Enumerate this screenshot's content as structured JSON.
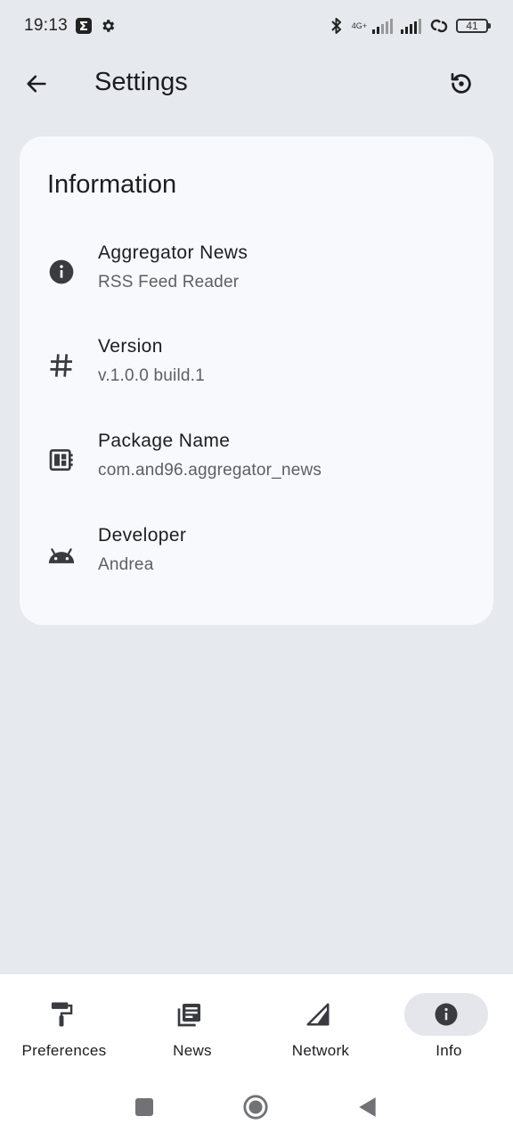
{
  "status_bar": {
    "time": "19:13",
    "network_label": "4G+",
    "battery": "41"
  },
  "top_bar": {
    "title": "Settings"
  },
  "card": {
    "title": "Information",
    "items": [
      {
        "icon": "info-icon",
        "label": "Aggregator News",
        "value": "RSS Feed Reader"
      },
      {
        "icon": "hashtag-icon",
        "label": "Version",
        "value": "v.1.0.0 build.1"
      },
      {
        "icon": "package-icon",
        "label": "Package Name",
        "value": "com.and96.aggregator_news"
      },
      {
        "icon": "android-icon",
        "label": "Developer",
        "value": "Andrea"
      }
    ]
  },
  "bottom_nav": {
    "items": [
      {
        "icon": "paint-roller-icon",
        "label": "Preferences",
        "active": false
      },
      {
        "icon": "news-icon",
        "label": "News",
        "active": false
      },
      {
        "icon": "signal-icon",
        "label": "Network",
        "active": false
      },
      {
        "icon": "info-icon",
        "label": "Info",
        "active": true
      }
    ]
  },
  "colors": {
    "background": "#e6e9ee",
    "card": "#f8f9fc",
    "active_pill": "#e4e6eb",
    "icon": "#3a3b40"
  }
}
